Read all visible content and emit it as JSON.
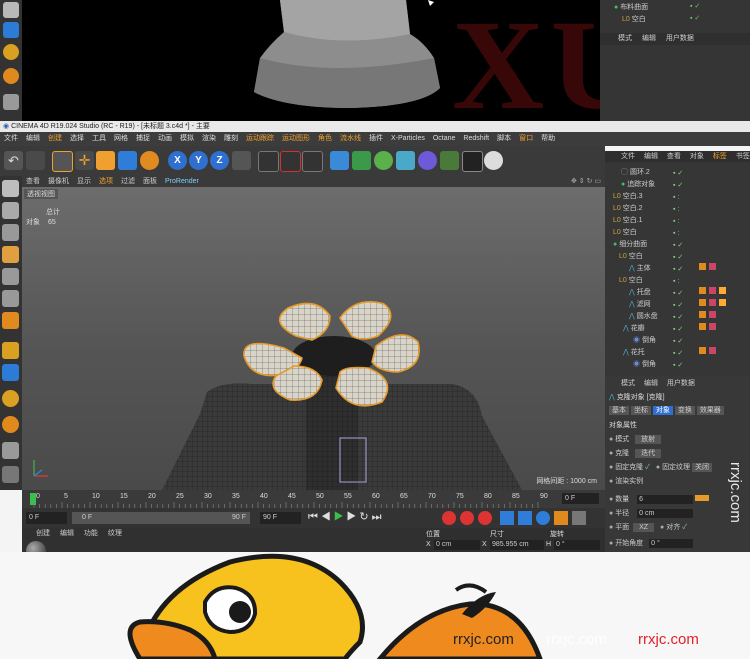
{
  "top": {
    "watermark": "XUE",
    "objects": [
      {
        "label": "布料曲面"
      },
      {
        "label": "空白"
      }
    ],
    "tabs": [
      "模式",
      "编辑",
      "用户数据"
    ]
  },
  "window": {
    "title": "CINEMA 4D R19.024 Studio (RC - R19) - [未标题 3.c4d *] - 主要"
  },
  "menubar": [
    "文件",
    "编辑",
    "创建",
    "选择",
    "工具",
    "网格",
    "捕捉",
    "动画",
    "模拟",
    "渲染",
    "雕刻",
    "运动跟踪",
    "运动图形",
    "角色",
    "流水线",
    "插件",
    "X-Particles",
    "Octane",
    "Redshift",
    "脚本",
    "窗口",
    "帮助"
  ],
  "viewport": {
    "menu": [
      "查看",
      "摄像机",
      "显示",
      "选项",
      "过滤",
      "面板",
      "ProRender"
    ],
    "label": "透视视图",
    "stats": {
      "total_label": "总计",
      "object_label": "对象",
      "object_count": "65"
    },
    "grid_spacing": "网格间距 : 1000 cm"
  },
  "timeline": {
    "ticks": [
      "0",
      "5",
      "10",
      "15",
      "20",
      "25",
      "30",
      "35",
      "40",
      "45",
      "50",
      "55",
      "60",
      "65",
      "70",
      "75",
      "80",
      "85",
      "90"
    ],
    "frame_end": "0 F"
  },
  "transport": {
    "start": "0 F",
    "current": "0 F",
    "end_a": "90 F",
    "end_b": "90 F"
  },
  "material_tabs": [
    "创建",
    "编辑",
    "功能",
    "纹理"
  ],
  "coords": {
    "headers": [
      "位置",
      "尺寸",
      "旋转"
    ],
    "x_label": "X",
    "x_pos": "0 cm",
    "x_size": "985.955 cm",
    "h_label": "H",
    "x_rot": "0 °"
  },
  "object_manager": {
    "tabs": [
      "文件",
      "编辑",
      "查看",
      "对象",
      "标签",
      "书签"
    ],
    "rows": [
      {
        "label": "圆环.2",
        "depth": 1
      },
      {
        "label": "追踪对象",
        "depth": 1
      },
      {
        "label": "空白.3",
        "depth": 0
      },
      {
        "label": "空白.2",
        "depth": 0
      },
      {
        "label": "空白.1",
        "depth": 0
      },
      {
        "label": "空白",
        "depth": 0
      },
      {
        "label": "细分曲面",
        "depth": 0
      },
      {
        "label": "空白",
        "depth": 1
      },
      {
        "label": "主体",
        "depth": 2
      },
      {
        "label": "空白",
        "depth": 1
      },
      {
        "label": "托盘",
        "depth": 2
      },
      {
        "label": "滤网",
        "depth": 2
      },
      {
        "label": "圆水盘",
        "depth": 2
      },
      {
        "label": "花瓣",
        "depth": 1
      },
      {
        "label": "倒角",
        "depth": 2
      },
      {
        "label": "花托",
        "depth": 1
      },
      {
        "label": "倒角",
        "depth": 2
      }
    ]
  },
  "attributes": {
    "tabs_top": [
      "模式",
      "编辑",
      "用户数据"
    ],
    "object_title": "克隆对象 [克隆]",
    "tabs": [
      "基本",
      "坐标",
      "对象",
      "变换",
      "效果器"
    ],
    "section": "对象属性",
    "mode_label": "模式",
    "mode_value": "放射",
    "clones_label": "克隆",
    "clones_value": "迭代",
    "fixed_clone": "固定克隆",
    "fixed_texture": "固定纹理",
    "fixed_texture_value": "关闭",
    "render_instances": "渲染实例",
    "count_label": "数量",
    "count_value": "6",
    "radius_label": "半径",
    "radius_value": "0 cm",
    "plane_label": "平面",
    "plane_value": "XZ",
    "align_label": "对齐",
    "start_angle_label": "开始角度",
    "start_angle_value": "0 °"
  },
  "sidebar_watermark": "rrxjc.com",
  "bottom": {
    "site_1": "rrxjc.com",
    "site_2": "rrxjc.com",
    "site_3": "rrxjc.com"
  },
  "colors": {
    "ui_dark": "#3a3a3a",
    "selection_orange": "#e69a2a",
    "duck_yellow": "#f7c21d",
    "duck_orange": "#ee8a1e",
    "site_red": "#e0222a"
  }
}
